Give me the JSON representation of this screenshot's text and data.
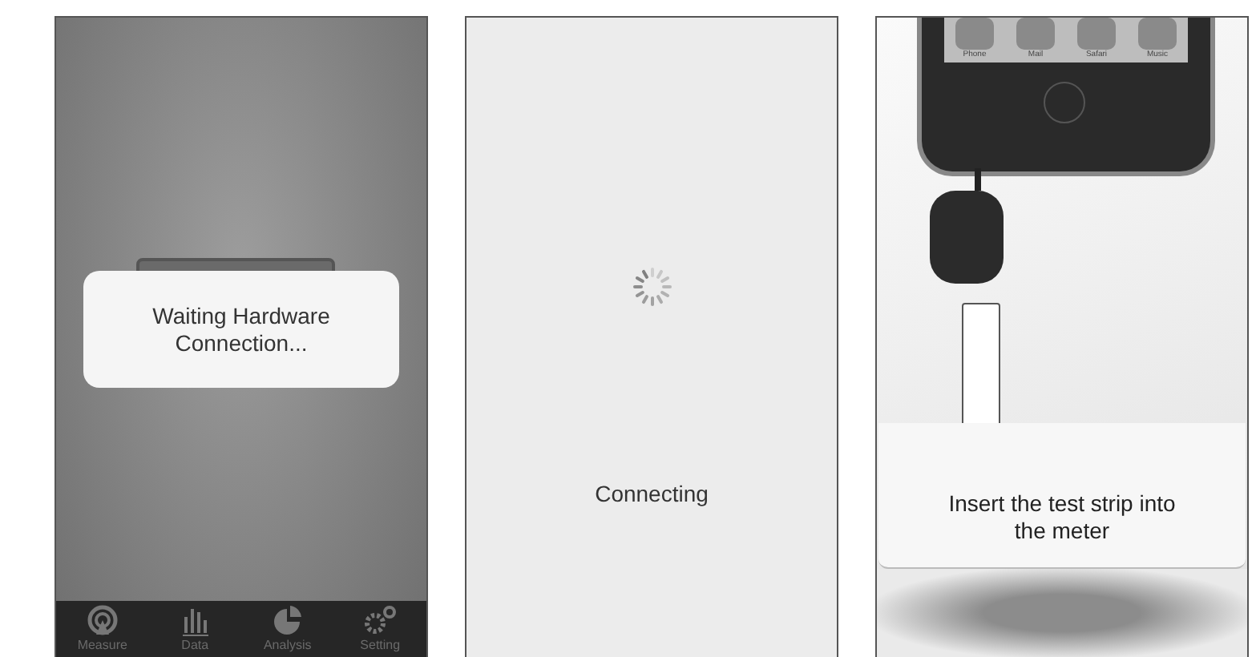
{
  "screens": [
    {
      "kind": "waiting",
      "dialog": [
        "Waiting Hardware",
        "Connection..."
      ],
      "tabs": [
        {
          "kind": "radar",
          "label": "Measure"
        },
        {
          "kind": "bars",
          "label": "Data"
        },
        {
          "kind": "pie",
          "label": "Analysis"
        },
        {
          "kind": "gears",
          "label": "Setting"
        }
      ]
    },
    {
      "kind": "connecting",
      "status": "Connecting"
    },
    {
      "kind": "insert",
      "dock": [
        "Phone",
        "Mail",
        "Safari",
        "Music"
      ],
      "instruction": [
        "Insert the test strip into",
        "the meter"
      ]
    }
  ]
}
